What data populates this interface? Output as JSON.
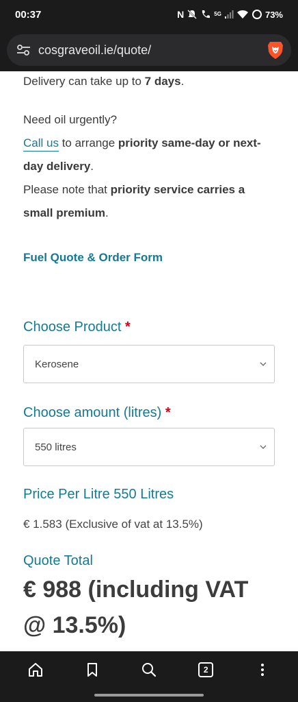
{
  "status_bar": {
    "time": "00:37",
    "battery": "73%",
    "network": "5G"
  },
  "browser": {
    "url": "cosgraveoil.ie/quote/",
    "tab_count": "2"
  },
  "content": {
    "delivery_prefix": "Delivery can take up to ",
    "delivery_days": "7 days",
    "delivery_suffix": ".",
    "urgent_question": "Need oil urgently?",
    "call_us": "Call us",
    "arrange_text": " to arrange ",
    "priority_delivery": "priority same-day or next-day delivery",
    "priority_delivery_suffix": ".",
    "note_prefix": "Please note that ",
    "note_bold": "priority service carries a small premium",
    "note_suffix": "."
  },
  "form": {
    "title": "Fuel Quote & Order Form",
    "product_label": "Choose Product",
    "required_mark": "*",
    "product_value": "Kerosene",
    "amount_label": "Choose amount (litres)",
    "amount_value": "550 litres",
    "price_label": "Price Per Litre 550 Litres",
    "price_value": "€ 1.583 (Exclusive of vat at 13.5%)",
    "total_label": "Quote Total",
    "total_value": "€ 988 (including VAT @ 13.5%)"
  },
  "colors": {
    "accent": "#137a94",
    "required": "#d0021b",
    "chrome": "#1b1b1b"
  },
  "icons": [
    "nfc-icon",
    "mute-icon",
    "wifi-call-icon",
    "signal-icon",
    "wifi-icon",
    "battery-icon",
    "site-settings-icon",
    "brave-lion-icon",
    "home-icon",
    "bookmark-icon",
    "search-icon",
    "tabs-icon",
    "more-icon",
    "chevron-down-icon"
  ]
}
